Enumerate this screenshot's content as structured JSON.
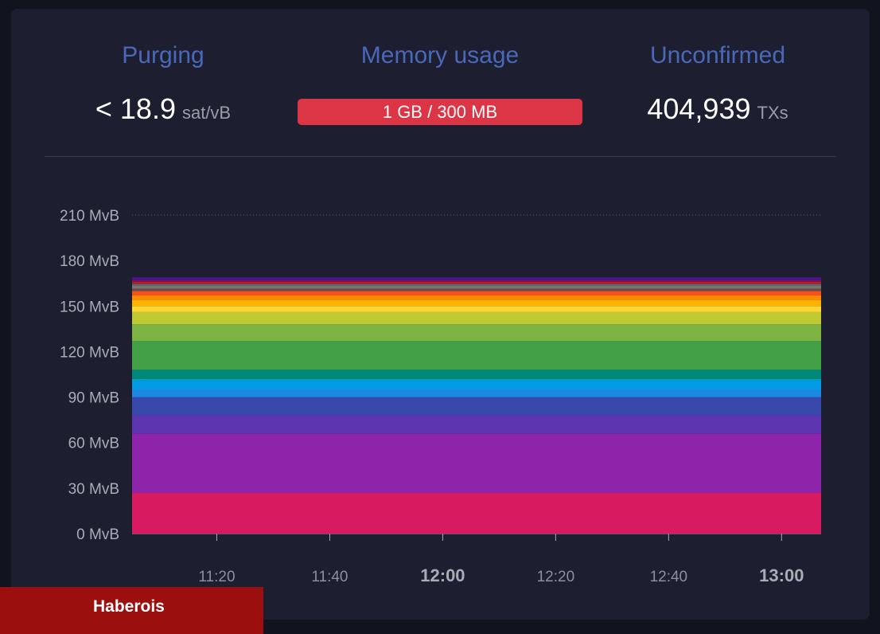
{
  "stats": {
    "purging": {
      "title": "Purging",
      "value": "< 18.9",
      "unit": "sat/vB"
    },
    "memory": {
      "title": "Memory usage",
      "bar_text": "1 GB / 300 MB",
      "bar_color": "#dc3545"
    },
    "unconfirmed": {
      "title": "Unconfirmed",
      "value": "404,939",
      "unit": "TXs"
    }
  },
  "banner": {
    "text": "Haberois"
  },
  "chart_data": {
    "type": "area",
    "stacked": true,
    "ylim": [
      0,
      210
    ],
    "yticks": [
      "0 MvB",
      "30 MvB",
      "60 MvB",
      "90 MvB",
      "120 MvB",
      "150 MvB",
      "180 MvB",
      "210 MvB"
    ],
    "xticks": [
      {
        "label": "11:20",
        "bold": false
      },
      {
        "label": "11:40",
        "bold": false
      },
      {
        "label": "12:00",
        "bold": true
      },
      {
        "label": "12:20",
        "bold": false
      },
      {
        "label": "12:40",
        "bold": false
      },
      {
        "label": "13:00",
        "bold": true
      }
    ],
    "x_range": [
      "11:05",
      "13:07"
    ],
    "series": [
      {
        "color": "#d81b60",
        "values": [
          27,
          27,
          27,
          27,
          27,
          27,
          27
        ]
      },
      {
        "color": "#8e24aa",
        "values": [
          39,
          39,
          39,
          39,
          39,
          39,
          39
        ]
      },
      {
        "color": "#5e35b1",
        "values": [
          12,
          12,
          12,
          12,
          12,
          12,
          12
        ]
      },
      {
        "color": "#3949ab",
        "values": [
          12,
          12,
          12,
          12,
          12,
          12,
          12
        ]
      },
      {
        "color": "#1e88e5",
        "values": [
          5,
          5,
          5,
          5,
          5,
          5,
          5
        ]
      },
      {
        "color": "#039be5",
        "values": [
          6,
          6,
          6,
          6,
          6,
          6,
          6
        ]
      },
      {
        "color": "#00acc1",
        "values": [
          1,
          1,
          1,
          1,
          1,
          1,
          1
        ]
      },
      {
        "color": "#00897b",
        "values": [
          6,
          6,
          6,
          6,
          6,
          6,
          6
        ]
      },
      {
        "color": "#43a047",
        "values": [
          19,
          19,
          19,
          19,
          19,
          19,
          19
        ]
      },
      {
        "color": "#7cb342",
        "values": [
          11,
          11,
          11,
          11,
          11,
          11,
          11
        ]
      },
      {
        "color": "#c0ca33",
        "values": [
          8,
          8,
          8,
          8,
          8,
          8,
          8
        ]
      },
      {
        "color": "#fdd835",
        "values": [
          4,
          4,
          4,
          4,
          4,
          4,
          4
        ]
      },
      {
        "color": "#ffb300",
        "values": [
          4,
          4,
          4,
          4,
          4,
          4,
          4
        ]
      },
      {
        "color": "#fb8c00",
        "values": [
          3,
          3,
          3,
          3,
          3,
          3,
          3
        ]
      },
      {
        "color": "#f4511e",
        "values": [
          3,
          3,
          3,
          3,
          3,
          3,
          3
        ]
      },
      {
        "color": "#6d4c41",
        "values": [
          1.5,
          1.5,
          1.5,
          1.5,
          1.5,
          1.5,
          1.5
        ]
      },
      {
        "color": "#757575",
        "values": [
          2,
          2,
          2,
          2,
          2,
          2,
          2
        ]
      },
      {
        "color": "#546e7a",
        "values": [
          1,
          1,
          1,
          1,
          1,
          1,
          1
        ]
      },
      {
        "color": "#b71c1c",
        "values": [
          1.5,
          1.5,
          1.5,
          1.5,
          1.5,
          1.5,
          1.5
        ]
      },
      {
        "color": "#880e4f",
        "values": [
          1,
          1,
          1,
          1,
          1,
          1,
          1
        ]
      },
      {
        "color": "#4a148c",
        "values": [
          2,
          2,
          2,
          2,
          2,
          2,
          2
        ]
      }
    ]
  }
}
